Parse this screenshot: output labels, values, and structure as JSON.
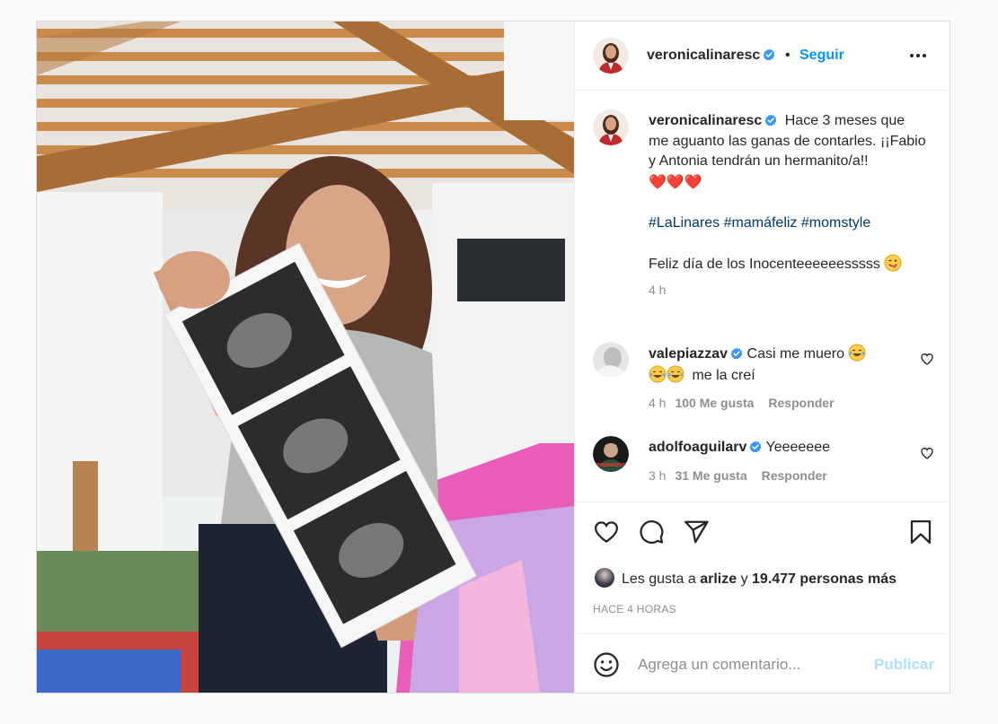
{
  "post": {
    "author": {
      "username": "veronicalinaresc",
      "follow_label": "Seguir",
      "separator": "•"
    },
    "caption": {
      "username": "veronicalinaresc",
      "line1": "Hace 3 meses que me aguanto las ganas de contarles. ¡¡Fabio y Antonia tendrán un hermanito/a!!",
      "hearts": "❤️❤️❤️",
      "hashtags": [
        "#LaLinares",
        "#mamáfeliz",
        "#momstyle"
      ],
      "line2": "Feliz día de los Inocenteeeeeesssss",
      "time": "4 h"
    },
    "comments": [
      {
        "username": "valepiazzav",
        "text_a": "Casi me muero",
        "text_b": "me la creí",
        "time": "4 h",
        "likes": "100 Me gusta",
        "reply": "Responder"
      },
      {
        "username": "adolfoaguilarv",
        "text_a": "Yeeeeeee",
        "time": "3 h",
        "likes": "31 Me gusta",
        "reply": "Responder"
      }
    ],
    "likes": {
      "prefix": "Les gusta a",
      "user": "arlize",
      "conj": "y",
      "others": "19.477 personas más"
    },
    "timestamp": "HACE 4 HORAS",
    "add_comment": {
      "placeholder": "Agrega un comentario...",
      "publish_label": "Publicar"
    },
    "colors": {
      "accent": "#0095f6",
      "verified": "#3897f0",
      "hashtag": "#00376b",
      "muted": "#8e8e8e",
      "publish_disabled": "#b2dffc"
    },
    "icons": [
      "verified-badge-icon",
      "more-icon",
      "heart-icon",
      "comment-icon",
      "share-icon",
      "bookmark-icon",
      "emoji-icon"
    ]
  }
}
